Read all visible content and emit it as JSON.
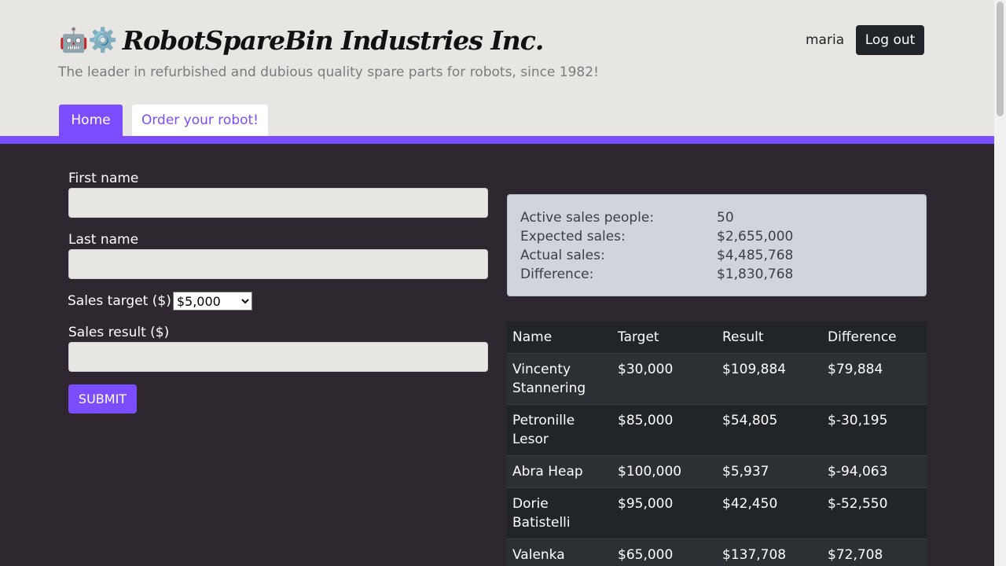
{
  "header": {
    "logo_emoji": "🤖⚙️",
    "title": "RobotSpareBin Industries Inc.",
    "subtitle": "The leader in refurbished and dubious quality spare parts for robots, since 1982!",
    "user": "maria",
    "logout_label": "Log out"
  },
  "tabs": [
    {
      "label": "Home"
    },
    {
      "label": "Order your robot!"
    }
  ],
  "form": {
    "first_name_label": "First name",
    "first_name_value": "",
    "last_name_label": "Last name",
    "last_name_value": "",
    "sales_target_label": "Sales target ($)",
    "sales_target_selected": "$5,000",
    "sales_result_label": "Sales result ($)",
    "sales_result_value": "",
    "submit_label": "SUBMIT"
  },
  "summary": {
    "rows": [
      {
        "key": "Active sales people:",
        "value": "50"
      },
      {
        "key": "Expected sales:",
        "value": "$2,655,000"
      },
      {
        "key": "Actual sales:",
        "value": "$4,485,768"
      },
      {
        "key": "Difference:",
        "value": "$1,830,768"
      }
    ]
  },
  "table": {
    "headers": [
      "Name",
      "Target",
      "Result",
      "Difference"
    ],
    "rows": [
      [
        "Vincenty Stannering",
        "$30,000",
        "$109,884",
        "$79,884"
      ],
      [
        "Petronille Lesor",
        "$85,000",
        "$54,805",
        "$-30,195"
      ],
      [
        "Abra Heap",
        "$100,000",
        "$5,937",
        "$-94,063"
      ],
      [
        "Dorie Batistelli",
        "$95,000",
        "$42,450",
        "$-52,550"
      ],
      [
        "Valenka",
        "$65,000",
        "$137,708",
        "$72,708"
      ]
    ]
  },
  "colors": {
    "accent": "#7c4dff",
    "header_bg": "#e8e6e3",
    "page_bg": "#2f2730",
    "dark_button": "#212529"
  }
}
